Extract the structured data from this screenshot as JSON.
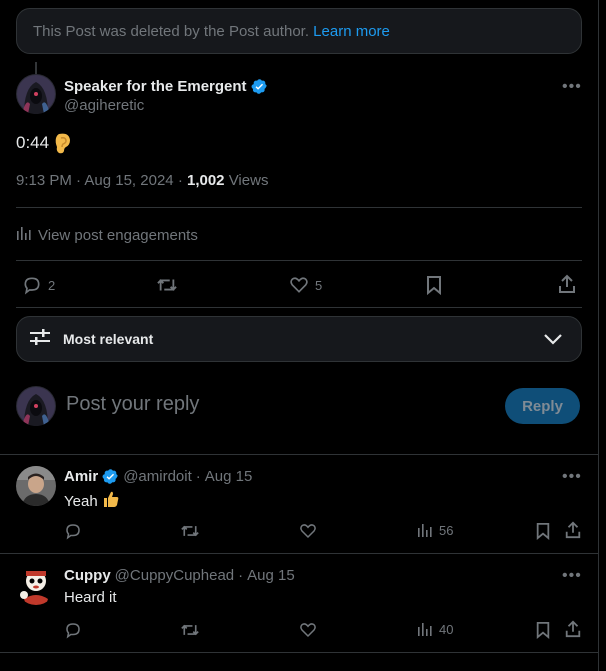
{
  "deleted_notice": {
    "text": "This Post was deleted by the Post author.",
    "link": "Learn more"
  },
  "post": {
    "author_name": "Speaker for the Emergent",
    "author_handle": "@agiheretic",
    "text": "0:44",
    "time": "9:13 PM",
    "date": "Aug 15, 2024",
    "views_count": "1,002",
    "views_label": "Views",
    "engagements_label": "View post engagements",
    "replies": "2",
    "likes": "5"
  },
  "filter": {
    "label": "Most relevant"
  },
  "composer": {
    "placeholder": "Post your reply",
    "button_label": "Reply"
  },
  "replies": [
    {
      "name": "Amir",
      "handle": "@amirdoit",
      "date": "Aug 15",
      "text": "Yeah",
      "views": "56",
      "verified": true
    },
    {
      "name": "Cuppy",
      "handle": "@CuppyCuphead",
      "date": "Aug 15",
      "text": "Heard it",
      "views": "40",
      "verified": false
    }
  ],
  "colors": {
    "background": "#000000",
    "accent": "#1d9bf0",
    "muted": "#71767b",
    "border": "#2f3336"
  }
}
